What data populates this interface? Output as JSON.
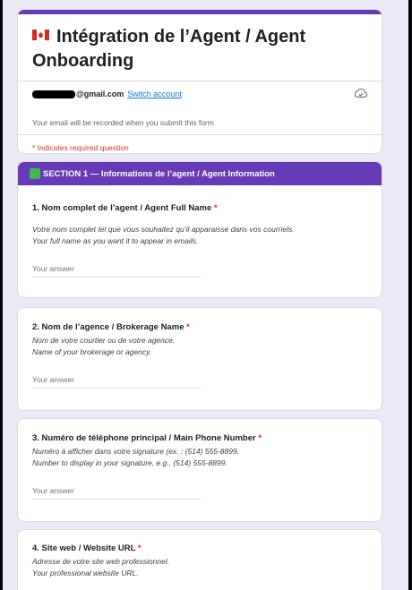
{
  "header": {
    "title_line1": "Intégration  de l’Agent / Agent",
    "title_line2": "Onboarding",
    "email_domain": "@gmail.com",
    "switch_account": "Switch account",
    "record_note": "Your email will be recorded when you submit this form",
    "required_note": "* Indicates required question"
  },
  "section": {
    "title": "SECTION 1 — Informations de l’agent / Agent Information"
  },
  "questions": [
    {
      "title": "1. Nom complet de l’agent / Agent Full Name",
      "required": "*",
      "desc_line1": "Votre nom complet tel que vous souhaitez qu’il apparaisse dans vos courriels.",
      "desc_line2": "Your full name as you want it to appear in emails.",
      "placeholder": "Your answer"
    },
    {
      "title": "2. Nom de l’agence / Brokerage Name",
      "required": "*",
      "desc_line1": "Nom de votre courtier ou de votre agence.",
      "desc_line2": "Name of your brokerage or agency.",
      "placeholder": "Your answer"
    },
    {
      "title": "3. Numéro de téléphone principal / Main Phone Number",
      "required": "*",
      "desc_line1": "Numéro à afficher dans votre signature (ex. : (514) 555-8899.",
      "desc_line2": "Number to display in your signature, e.g., (514) 555-8899.",
      "placeholder": "Your answer"
    },
    {
      "title": "4. Site web / Website URL",
      "required": "*",
      "desc_line1": "Adresse de votre site web professionnel.",
      "desc_line2": "Your professional website URL."
    }
  ],
  "colors": {
    "theme": "#673ab7",
    "background": "#ece8f5",
    "required": "#d93025",
    "link": "#1a73e8"
  },
  "icons": [
    "canada-flag-icon",
    "cloud-save-icon",
    "green-square-icon"
  ]
}
